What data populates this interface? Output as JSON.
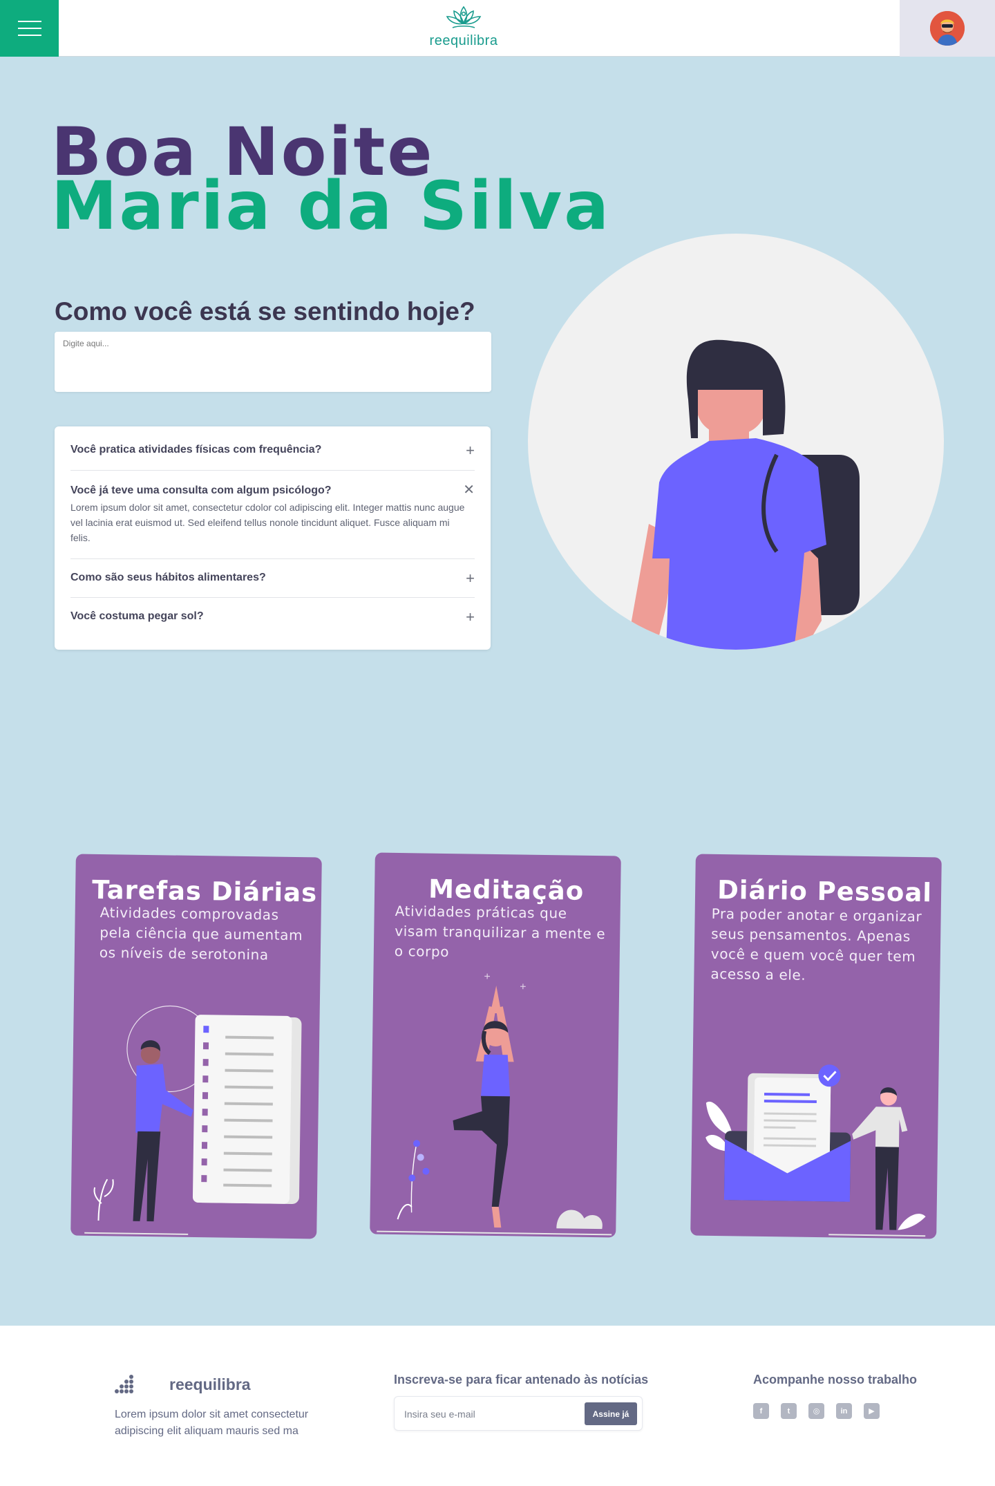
{
  "header": {
    "brand": "reequilibra",
    "menu_icon": "hamburger-menu-icon",
    "avatar_icon": "user-avatar"
  },
  "greeting": {
    "line1": "Boa Noite",
    "line2": "Maria da Silva"
  },
  "feeling": {
    "question": "Como você está se sentindo hoje?",
    "placeholder": "Digite aqui..."
  },
  "faq": {
    "items": [
      {
        "question": "Você pratica atividades físicas com frequência?",
        "toggle": "+"
      },
      {
        "question": "Você já teve uma consulta com algum psicólogo?",
        "answer": "Lorem ipsum dolor sit amet, consectetur cdolor col adipiscing elit. Integer mattis nunc augue vel lacinia erat euismod ut. Sed eleifend tellus nonole tincidunt aliquet. Fusce aliquam mi felis.",
        "toggle": "✕"
      },
      {
        "question": "Como são seus hábitos alimentares?",
        "toggle": "+"
      },
      {
        "question": "Você costuma pegar sol?",
        "toggle": "+"
      }
    ]
  },
  "cards": [
    {
      "title": "Tarefas Diárias",
      "description": "Atividades comprovadas pela ciência que aumentam os níveis de serotonina"
    },
    {
      "title": "Meditação",
      "description": "Atividades práticas que visam tranquilizar a mente e o corpo"
    },
    {
      "title": "Diário Pessoal",
      "description": "Pra poder anotar e organizar seus pensamentos. Apenas você e quem você quer tem acesso a ele."
    }
  ],
  "footer": {
    "brand": "reequilibra",
    "description": "Lorem ipsum dolor sit amet consectetur adipiscing elit aliquam mauris sed ma",
    "newsletter_title": "Inscreva-se para ficar antenado às notícias",
    "email_placeholder": "Insira seu e-mail",
    "subscribe_label": "Assine já",
    "follow_title": "Acompanhe nosso trabalho",
    "social": [
      {
        "icon": "facebook-icon",
        "glyph": "f"
      },
      {
        "icon": "twitter-icon",
        "glyph": "t"
      },
      {
        "icon": "instagram-icon",
        "glyph": "◎"
      },
      {
        "icon": "linkedin-icon",
        "glyph": "in"
      },
      {
        "icon": "youtube-icon",
        "glyph": "▶"
      }
    ]
  },
  "colors": {
    "accent_green": "#0eac7e",
    "accent_purple": "#4a3571",
    "card_purple": "#9463aa",
    "background": "#c5dfea"
  }
}
